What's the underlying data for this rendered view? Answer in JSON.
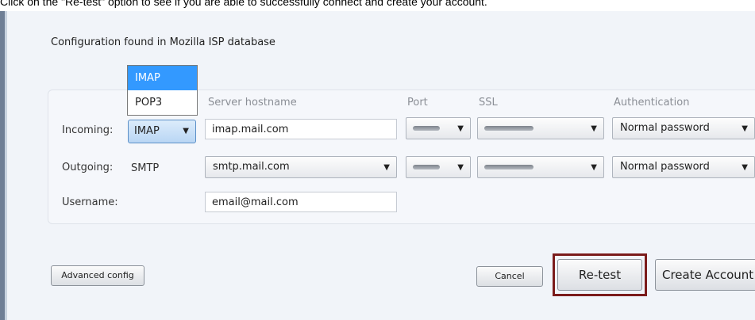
{
  "caption": "Click on the \"Re-test\" option to see if you are able to successfully connect and create your account.",
  "dialog": {
    "heading": "Configuration found in Mozilla ISP database",
    "columns": {
      "server_hostname": "Server hostname",
      "port": "Port",
      "ssl": "SSL",
      "authentication": "Authentication"
    },
    "incoming": {
      "label": "Incoming:",
      "protocol": "IMAP",
      "protocol_options": [
        "IMAP",
        "POP3"
      ],
      "hostname": "imap.mail.com",
      "authentication": "Normal password"
    },
    "outgoing": {
      "label": "Outgoing:",
      "protocol": "SMTP",
      "hostname": "smtp.mail.com",
      "authentication": "Normal password"
    },
    "username": {
      "label": "Username:",
      "value": "email@mail.com"
    },
    "buttons": {
      "advanced": "Advanced config",
      "cancel": "Cancel",
      "retest": "Re-test",
      "create": "Create Account"
    }
  },
  "colors": {
    "highlight_frame": "#7b1b1b",
    "selected_option": "#3399ff"
  }
}
